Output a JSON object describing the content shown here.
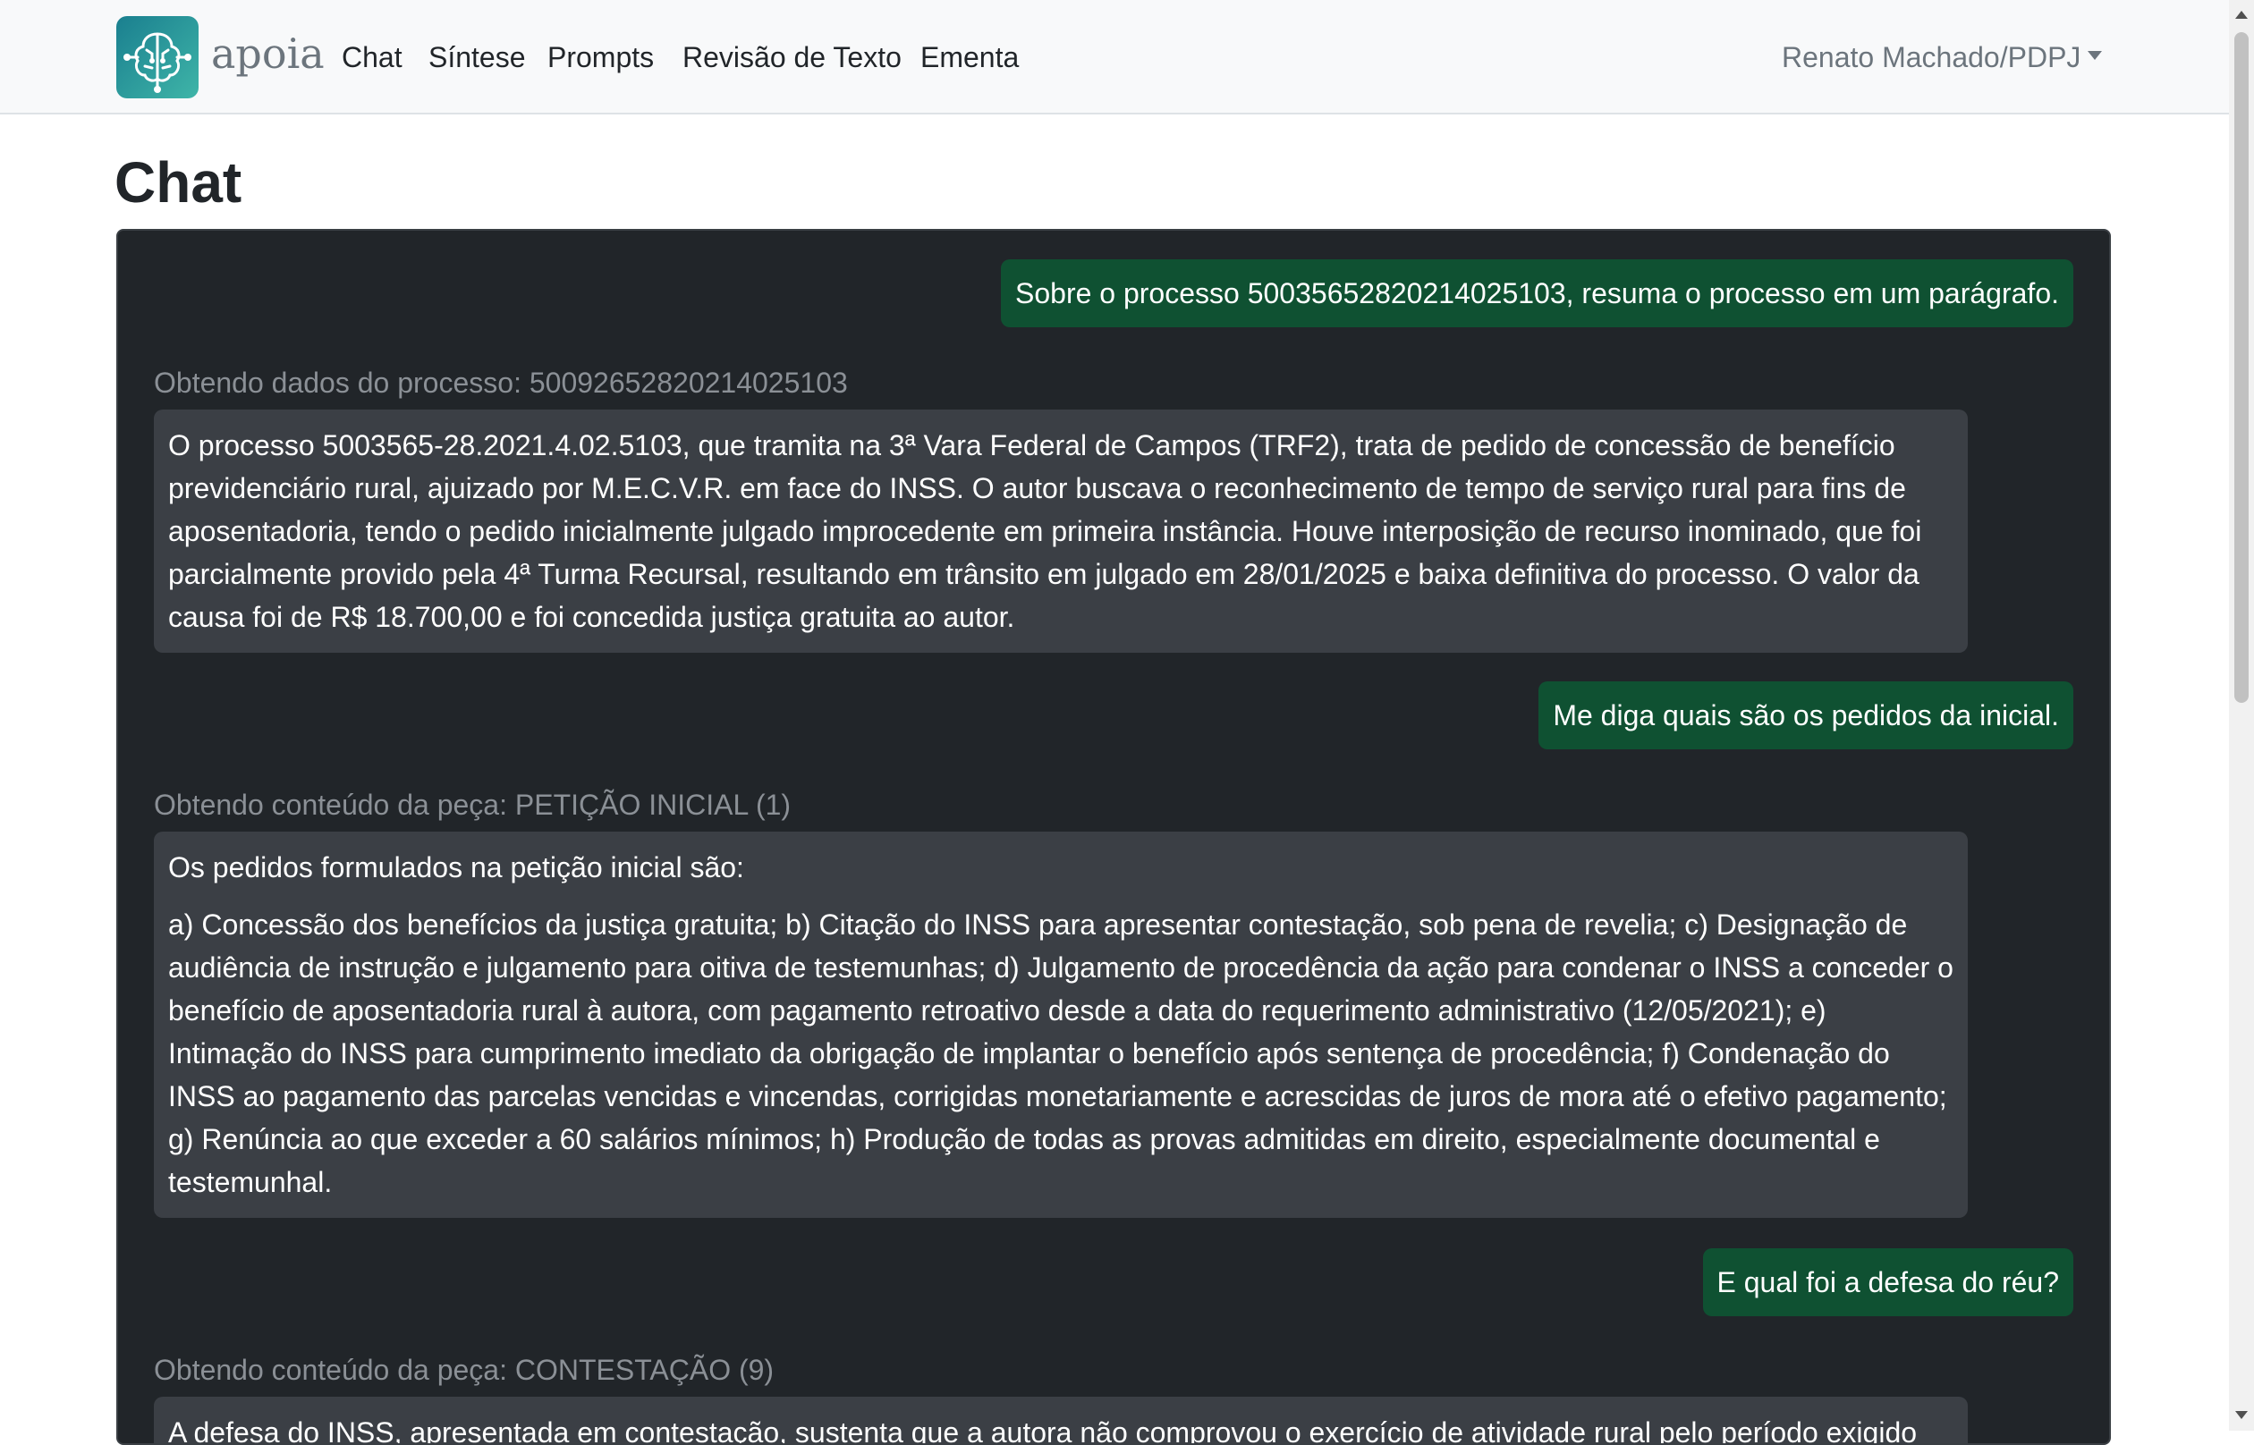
{
  "brand": {
    "name": "apoia",
    "logo_icon": "brain-circuit-icon"
  },
  "nav": {
    "items": [
      {
        "label": "Chat"
      },
      {
        "label": "Síntese"
      },
      {
        "label": "Prompts"
      },
      {
        "label": "Revisão de Texto"
      },
      {
        "label": "Ementa"
      }
    ],
    "user": "Renato Machado/PDPJ",
    "user_icon": "caret-down-icon"
  },
  "page": {
    "title": "Chat"
  },
  "conversation": [
    {
      "role": "user",
      "text": "Sobre o processo 50035652820214025103, resuma o processo em um parágrafo."
    },
    {
      "role": "status",
      "text": "Obtendo dados do processo: 50092652820214025103"
    },
    {
      "role": "assistant",
      "paragraphs": [
        "O processo 5003565-28.2021.4.02.5103, que tramita na 3ª Vara Federal de Campos (TRF2), trata de pedido de concessão de benefício previdenciário rural, ajuizado por M.E.C.V.R. em face do INSS. O autor buscava o reconhecimento de tempo de serviço rural para fins de aposentadoria, tendo o pedido inicialmente julgado improcedente em primeira instância. Houve interposição de recurso inominado, que foi parcialmente provido pela 4ª Turma Recursal, resultando em trânsito em julgado em 28/01/2025 e baixa definitiva do processo. O valor da causa foi de R$ 18.700,00 e foi concedida justiça gratuita ao autor."
      ]
    },
    {
      "role": "user",
      "text": "Me diga quais são os pedidos da inicial."
    },
    {
      "role": "status",
      "text": "Obtendo conteúdo da peça: PETIÇÃO INICIAL (1)"
    },
    {
      "role": "assistant",
      "paragraphs": [
        "Os pedidos formulados na petição inicial são:",
        "a) Concessão dos benefícios da justiça gratuita; b) Citação do INSS para apresentar contestação, sob pena de revelia; c) Designação de audiência de instrução e julgamento para oitiva de testemunhas; d) Julgamento de procedência da ação para condenar o INSS a conceder o benefício de aposentadoria rural à autora, com pagamento retroativo desde a data do requerimento administrativo (12/05/2021); e) Intimação do INSS para cumprimento imediato da obrigação de implantar o benefício após sentença de procedência; f) Condenação do INSS ao pagamento das parcelas vencidas e vincendas, corrigidas monetariamente e acrescidas de juros de mora até o efetivo pagamento; g) Renúncia ao que exceder a 60 salários mínimos; h) Produção de todas as provas admitidas em direito, especialmente documental e testemunhal."
      ]
    },
    {
      "role": "user",
      "text": "E qual foi a defesa do réu?"
    },
    {
      "role": "status",
      "text": "Obtendo conteúdo da peça: CONTESTAÇÃO (9)"
    },
    {
      "role": "assistant",
      "paragraphs": [
        "A defesa do INSS, apresentada em contestação, sustenta que a autora não comprovou o exercício de atividade rural pelo período exigido de"
      ]
    }
  ]
}
